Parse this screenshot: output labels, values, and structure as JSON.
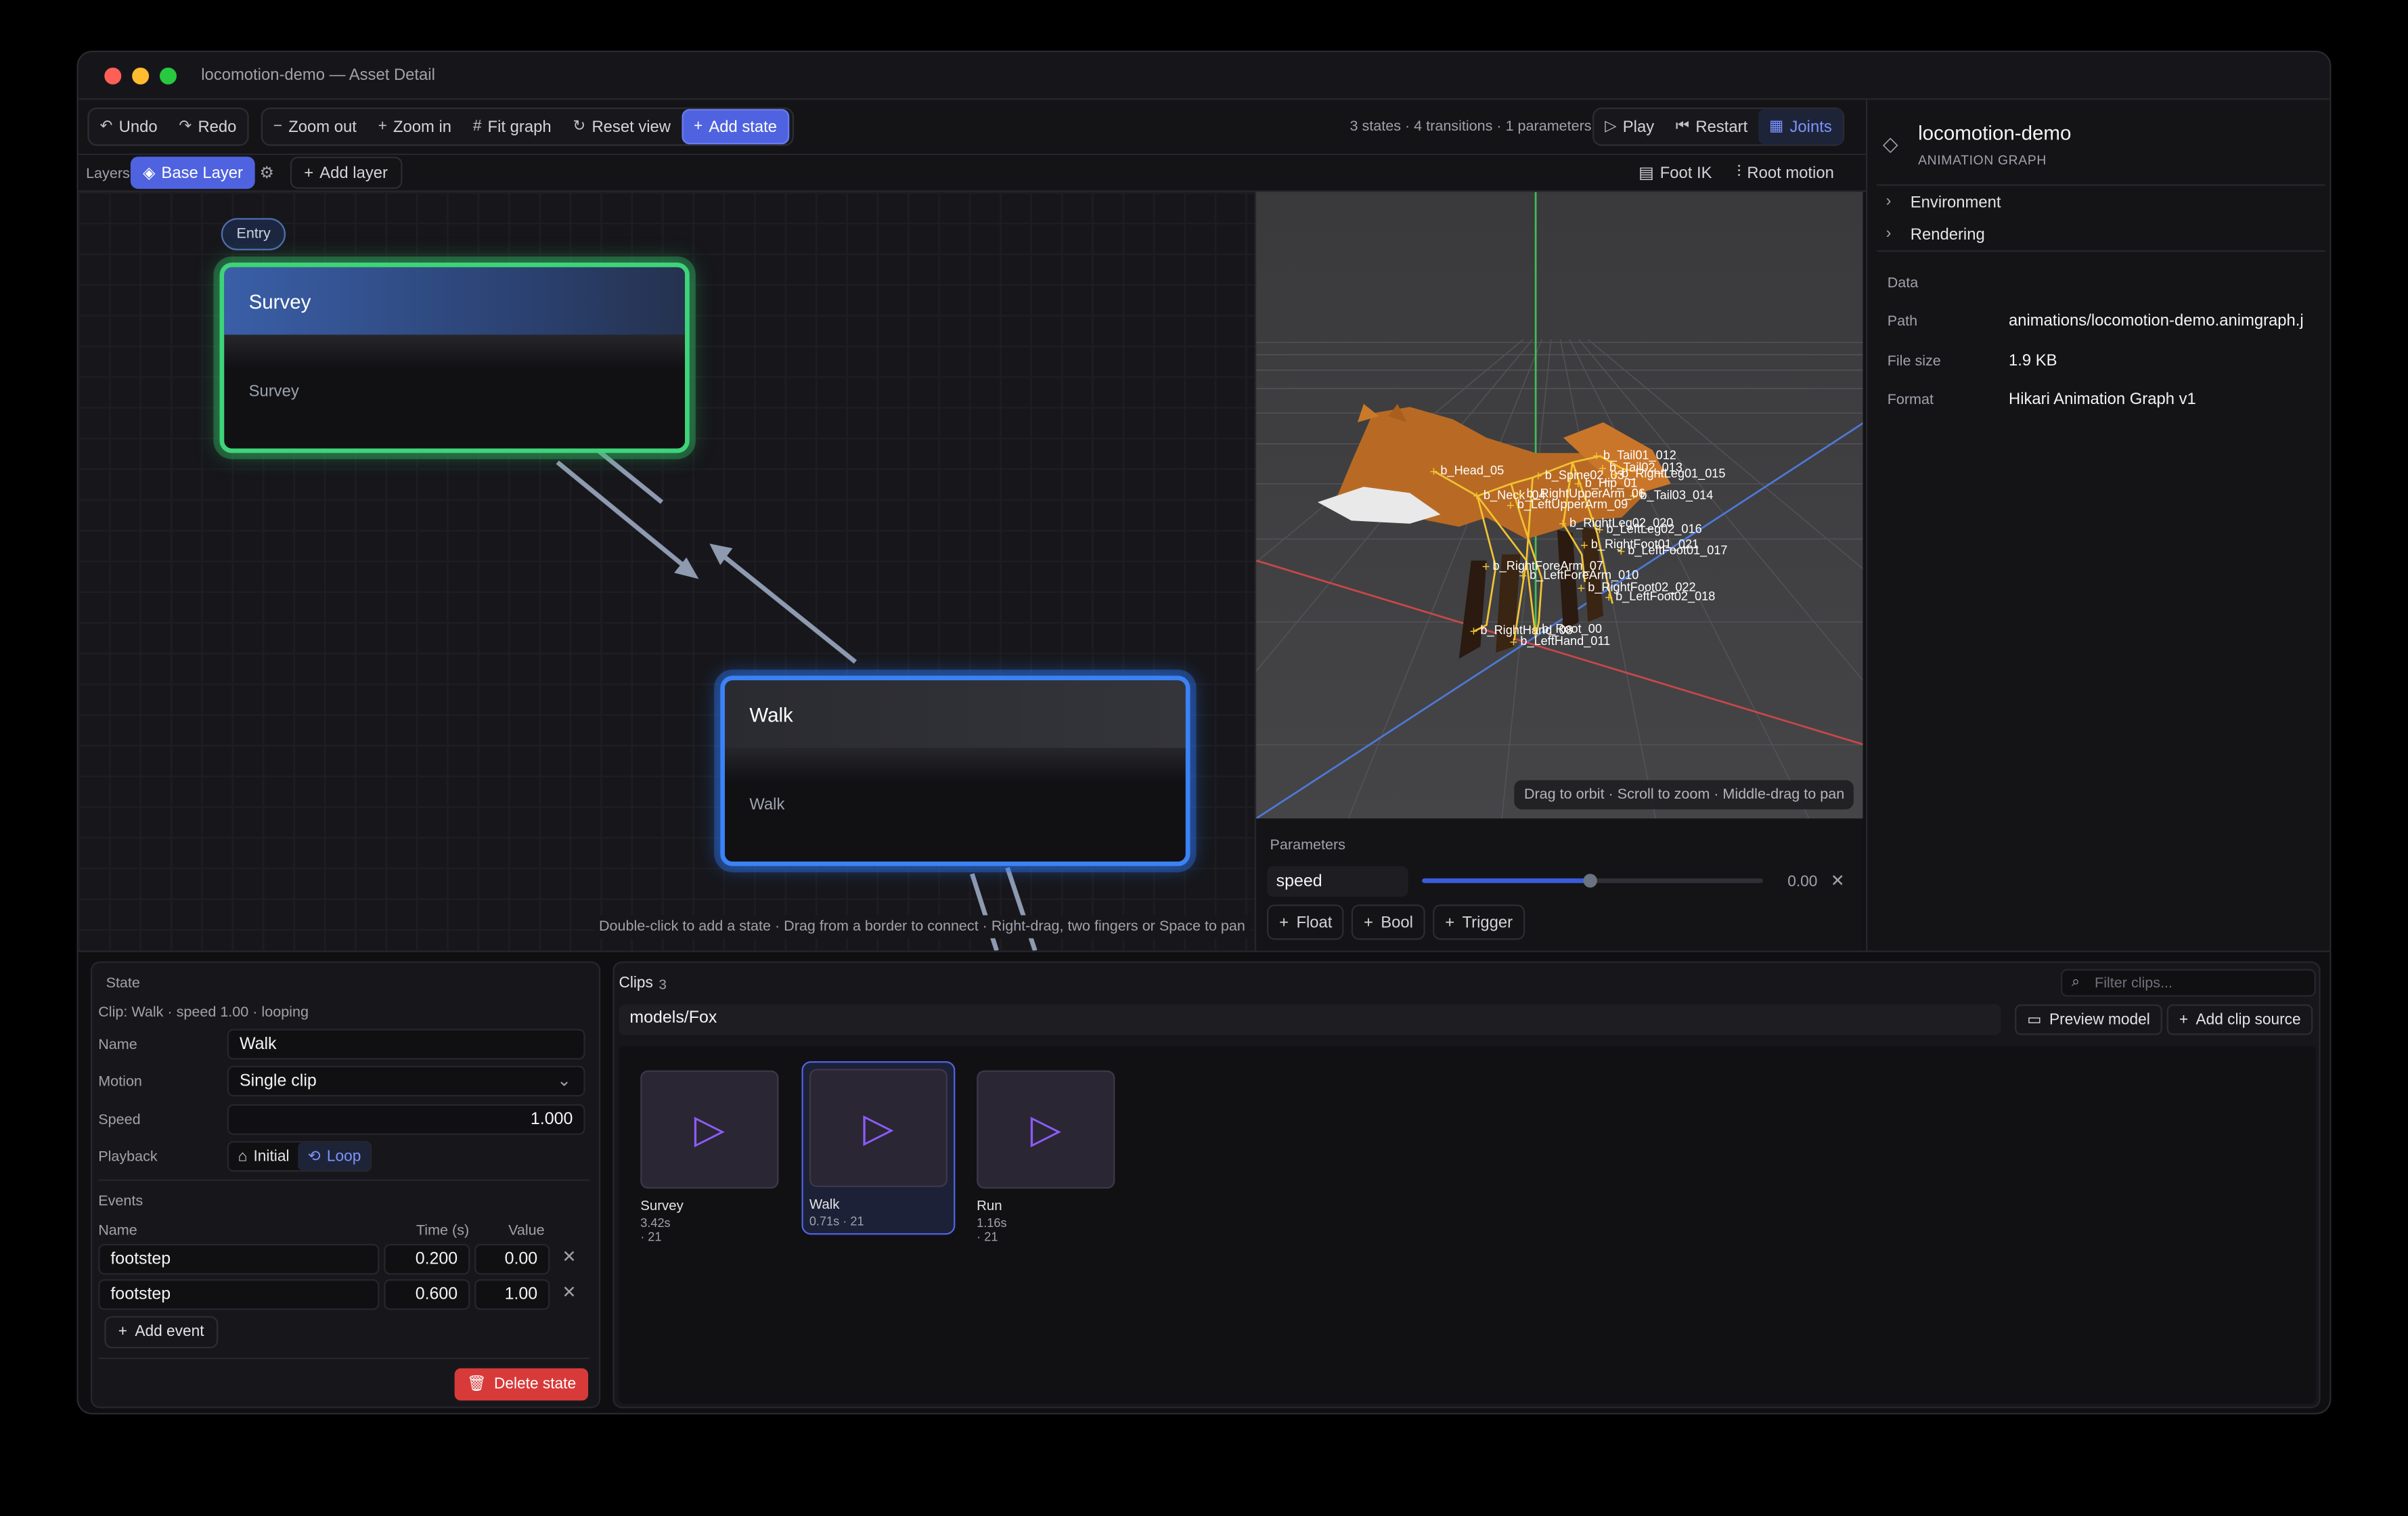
{
  "window": {
    "title": "locomotion-demo — Asset Detail"
  },
  "toolbar": {
    "undo": "Undo",
    "redo": "Redo",
    "zoom_out": "Zoom out",
    "zoom_in": "Zoom in",
    "fit_graph": "Fit graph",
    "reset_view": "Reset view",
    "add_state": "Add state",
    "stats": "3 states · 4 transitions · 1 parameters",
    "play": "Play",
    "restart": "Restart",
    "joints": "Joints"
  },
  "layers": {
    "label": "Layers",
    "active": "Base Layer",
    "add": "Add layer",
    "foot_ik": "Foot IK",
    "root_motion": "Root motion"
  },
  "graph": {
    "entry": "Entry",
    "nodes": [
      {
        "title": "Survey",
        "clip": "Survey"
      },
      {
        "title": "Walk",
        "clip": "Walk"
      }
    ],
    "hint": "Double-click to add a state · Drag from a border to connect · Right-drag, two fingers or Space to pan"
  },
  "viewport": {
    "hint": "Drag to orbit · Scroll to zoom · Middle-drag to pan",
    "joints": [
      "b_Head_05",
      "b_Neck_04",
      "b_Spine02_03",
      "b_Hip_01",
      "b_Tail01_012",
      "b_Tail02_013",
      "b_Tail03_014",
      "b_LeftUpperArm_09",
      "b_RightUpperArm_06",
      "b_RightLeg01_015",
      "b_RightLeg02_020",
      "b_LeftLeg02_016",
      "b_RightFoot01_021",
      "b_LeftFoot01_017",
      "b_RightForeArm_07",
      "b_LeftForeArm_010",
      "b_RightFoot02_022",
      "b_LeftFoot02_018",
      "b_RightHand_08",
      "b_Root_00",
      "b_LeftHand_011"
    ]
  },
  "parameters": {
    "title": "Parameters",
    "items": [
      {
        "name": "speed",
        "value": "0.00",
        "fill": 0.49
      }
    ],
    "add_float": "Float",
    "add_bool": "Bool",
    "add_trigger": "Trigger"
  },
  "inspector": {
    "title": "locomotion-demo",
    "subtitle": "ANIMATION GRAPH",
    "sections": [
      "Environment",
      "Rendering"
    ],
    "data_label": "Data",
    "rows": [
      {
        "key": "Path",
        "value": "animations/locomotion-demo.animgraph.j"
      },
      {
        "key": "File size",
        "value": "1.9 KB"
      },
      {
        "key": "Format",
        "value": "Hikari Animation Graph v1"
      }
    ]
  },
  "state": {
    "title": "State",
    "summary": "Clip: Walk · speed 1.00 · looping",
    "name_label": "Name",
    "name": "Walk",
    "motion_label": "Motion",
    "motion": "Single clip",
    "speed_label": "Speed",
    "speed": "1.000",
    "playback_label": "Playback",
    "initial": "Initial",
    "loop": "Loop",
    "events_label": "Events",
    "col_name": "Name",
    "col_time": "Time (s)",
    "col_value": "Value",
    "events": [
      {
        "name": "footstep",
        "time": "0.200",
        "value": "0.00"
      },
      {
        "name": "footstep",
        "time": "0.600",
        "value": "1.00"
      }
    ],
    "add_event": "Add event",
    "delete": "Delete state"
  },
  "clips": {
    "title": "Clips",
    "count": "3",
    "filter_placeholder": "Filter clips...",
    "source": "models/Fox",
    "preview": "Preview model",
    "add_source": "Add clip source",
    "items": [
      {
        "name": "Survey",
        "meta": "3.42s · 21"
      },
      {
        "name": "Walk",
        "meta": "0.71s · 21"
      },
      {
        "name": "Run",
        "meta": "1.16s · 21"
      }
    ]
  },
  "colors": {
    "accent": "#4f63e0",
    "survey_glow": "#34c36a",
    "walk_glow": "#2f7bff",
    "danger": "#d83a3a"
  }
}
